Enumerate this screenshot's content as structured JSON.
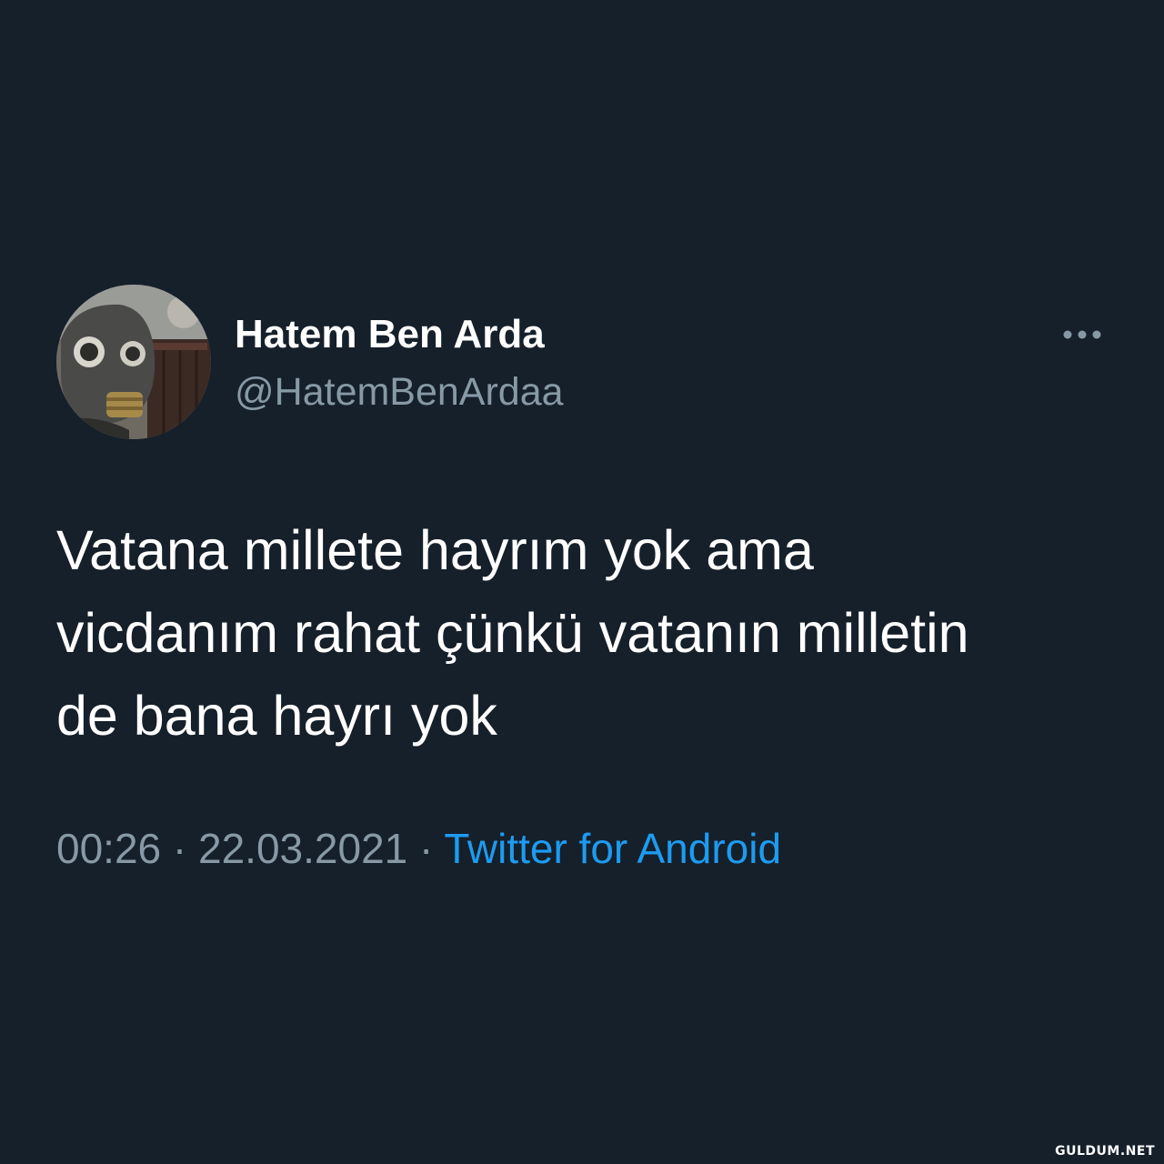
{
  "tweet": {
    "author": {
      "display_name": "Hatem Ben Arda",
      "handle": "@HatemBenArdaa",
      "avatar_icon": "gas-mask-avatar"
    },
    "more_icon": "more-horizontal-icon",
    "text": "Vatana millete hayrım yok ama\nvicdanım rahat çünkü vatanın milletin\nde bana hayrı yok",
    "time": "00:26",
    "separator": " · ",
    "date": "22.03.2021",
    "source": "Twitter for Android"
  },
  "watermark": "GULDUM.NET",
  "colors": {
    "background": "#15202b",
    "text_primary": "#ffffff",
    "text_secondary": "#8899a6",
    "accent": "#1d9bf0"
  }
}
